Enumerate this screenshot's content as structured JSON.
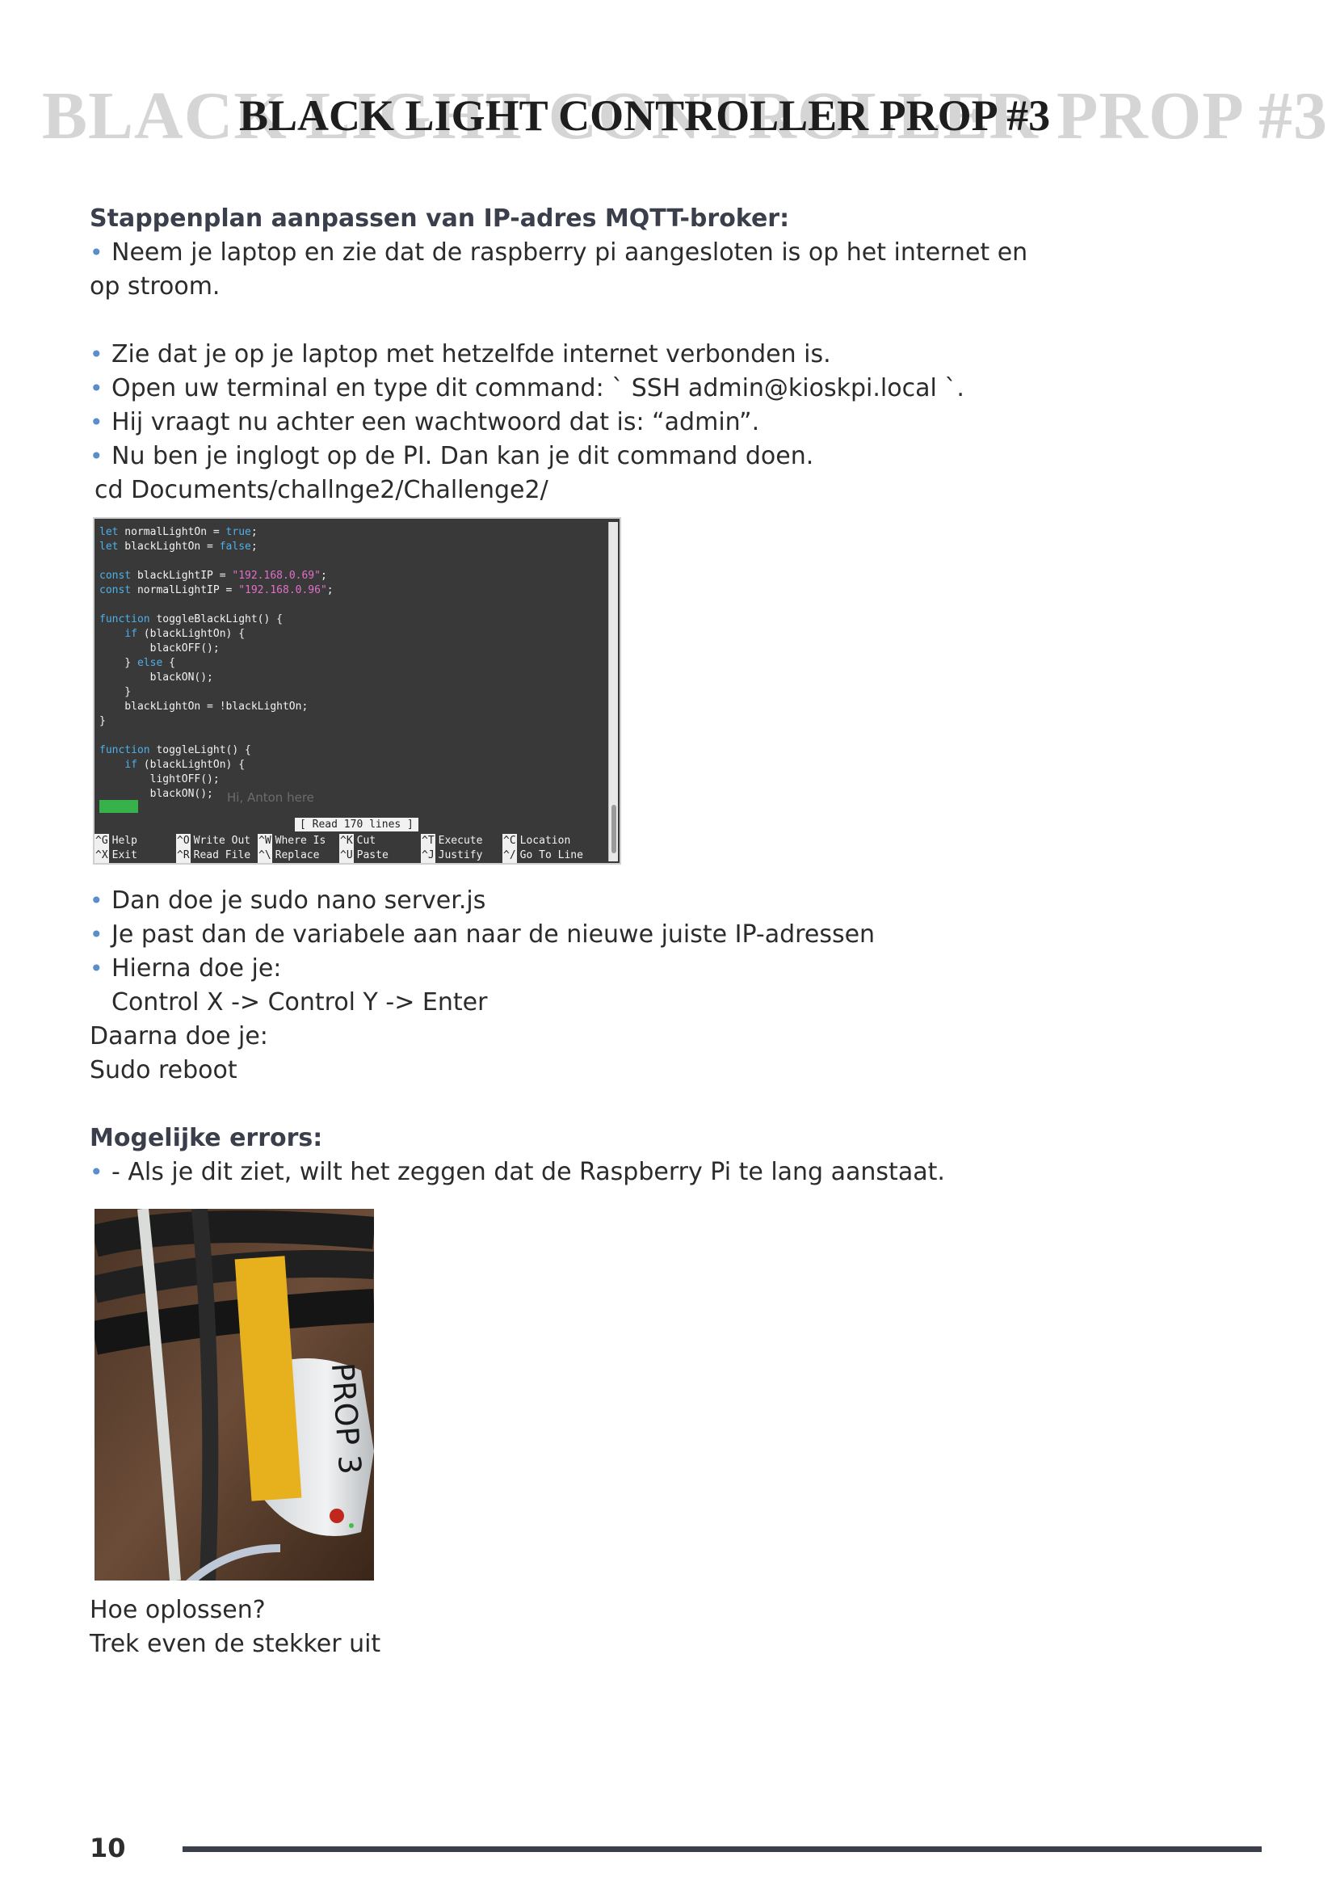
{
  "title": "BLACK LIGHT CONTROLLER PROP #3",
  "section1": {
    "heading": "Stappenplan aanpassen van IP-adres MQTT-broker:",
    "intro_line1": "Neem je laptop en zie dat de raspberry pi aangesloten is op het internet en",
    "intro_line2": "op stroom.",
    "bullets": [
      "Zie dat je op je laptop met hetzelfde internet verbonden is.",
      "Open uw terminal en type dit command: ` SSH admin@kioskpi.local `.",
      "Hij vraagt nu achter een wachtwoord dat is: “admin”.",
      "Nu ben je inglogt op de PI. Dan kan je dit command doen."
    ],
    "cd_command": "cd Documents/challnge2/Challenge2/"
  },
  "terminal": {
    "code_lines": [
      {
        "pre": "",
        "kw": "let",
        "post": " normalLightOn = ",
        "val": "true",
        "valtype": "kw",
        "end": ";"
      },
      {
        "pre": "",
        "kw": "let",
        "post": " blackLightOn = ",
        "val": "false",
        "valtype": "kw",
        "end": ";"
      },
      {
        "pre": "",
        "kw": "",
        "post": "",
        "val": "",
        "valtype": "",
        "end": ""
      },
      {
        "pre": "",
        "kw": "const",
        "post": " blackLightIP = ",
        "val": "\"192.168.0.69\"",
        "valtype": "str",
        "end": ";"
      },
      {
        "pre": "",
        "kw": "const",
        "post": " normalLightIP = ",
        "val": "\"192.168.0.96\"",
        "valtype": "str",
        "end": ";"
      },
      {
        "pre": "",
        "kw": "",
        "post": "",
        "val": "",
        "valtype": "",
        "end": ""
      },
      {
        "pre": "",
        "kw": "function",
        "post": " toggleBlackLight() {",
        "val": "",
        "valtype": "",
        "end": ""
      },
      {
        "pre": "    ",
        "kw": "if",
        "post": " (blackLightOn) {",
        "val": "",
        "valtype": "",
        "end": ""
      },
      {
        "pre": "        blackOFF();",
        "kw": "",
        "post": "",
        "val": "",
        "valtype": "",
        "end": ""
      },
      {
        "pre": "    } ",
        "kw": "else",
        "post": " {",
        "val": "",
        "valtype": "",
        "end": ""
      },
      {
        "pre": "        blackON();",
        "kw": "",
        "post": "",
        "val": "",
        "valtype": "",
        "end": ""
      },
      {
        "pre": "    }",
        "kw": "",
        "post": "",
        "val": "",
        "valtype": "",
        "end": ""
      },
      {
        "pre": "    blackLightOn = !blackLightOn;",
        "kw": "",
        "post": "",
        "val": "",
        "valtype": "",
        "end": ""
      },
      {
        "pre": "}",
        "kw": "",
        "post": "",
        "val": "",
        "valtype": "",
        "end": ""
      },
      {
        "pre": "",
        "kw": "",
        "post": "",
        "val": "",
        "valtype": "",
        "end": ""
      },
      {
        "pre": "",
        "kw": "function",
        "post": " toggleLight() {",
        "val": "",
        "valtype": "",
        "end": ""
      },
      {
        "pre": "    ",
        "kw": "if",
        "post": " (blackLightOn) {",
        "val": "",
        "valtype": "",
        "end": ""
      },
      {
        "pre": "        lightOFF();",
        "kw": "",
        "post": "",
        "val": "",
        "valtype": "",
        "end": ""
      },
      {
        "pre": "        blackON();",
        "kw": "",
        "post": "",
        "val": "",
        "valtype": "",
        "end": ""
      }
    ],
    "overlay_text": "Hi, Anton here",
    "status": "[ Read 170 lines ]",
    "menu": [
      [
        {
          "key": "^G",
          "label": "Help"
        },
        {
          "key": "^O",
          "label": "Write Out"
        },
        {
          "key": "^W",
          "label": "Where Is"
        },
        {
          "key": "^K",
          "label": "Cut"
        },
        {
          "key": "^T",
          "label": "Execute"
        },
        {
          "key": "^C",
          "label": "Location"
        }
      ],
      [
        {
          "key": "^X",
          "label": "Exit"
        },
        {
          "key": "^R",
          "label": "Read File"
        },
        {
          "key": "^\\",
          "label": "Replace"
        },
        {
          "key": "^U",
          "label": "Paste"
        },
        {
          "key": "^J",
          "label": "Justify"
        },
        {
          "key": "^/",
          "label": "Go To Line"
        }
      ]
    ]
  },
  "section2": {
    "bullets": [
      "Dan doe je sudo nano server.js",
      "Je past dan de variabele aan naar de nieuwe juiste IP-adressen",
      "Hierna doe je:"
    ],
    "keys_line": "Control X -> Control Y -> Enter",
    "after1": "Daarna doe je:",
    "after2": "Sudo reboot"
  },
  "section3": {
    "heading": "Mogelijke errors:",
    "bullet": "- Als je dit ziet, wilt het zeggen dat de Raspberry Pi te lang aanstaat.",
    "photo_tape_text": "PROP 3",
    "fix_q": "Hoe oplossen?",
    "fix_a": "Trek even de stekker uit"
  },
  "footer": {
    "page_number": "10"
  },
  "colors": {
    "bullet": "#5b8ec9",
    "heading": "#3a3f4b",
    "rule": "#3a3f4b",
    "terminal_bg": "#393939"
  }
}
